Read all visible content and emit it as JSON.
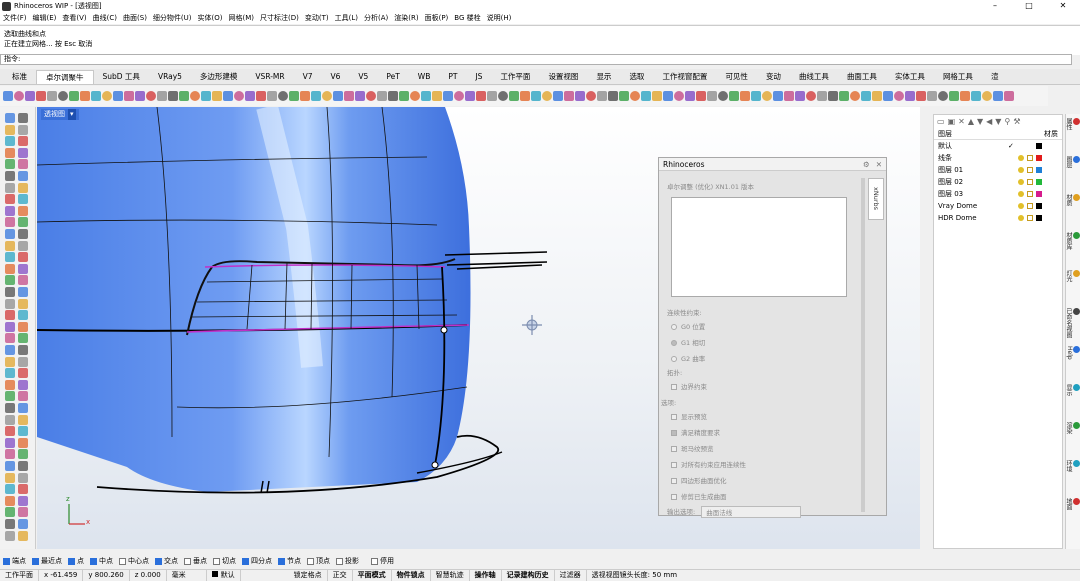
{
  "window": {
    "title": "Rhinoceros WIP - [透视图]",
    "controls": [
      "–",
      "□",
      "✕"
    ]
  },
  "menu": [
    "文件(F)",
    "编辑(E)",
    "查看(V)",
    "曲线(C)",
    "曲面(S)",
    "细分物件(U)",
    "实体(O)",
    "网格(M)",
    "尺寸标注(D)",
    "变动(T)",
    "工具(L)",
    "分析(A)",
    "渲染(R)",
    "面板(P)",
    "BG 楼栓",
    "说明(H)"
  ],
  "command": {
    "history1": "选取曲线和点",
    "history2": "正在建立网格... 按 Esc 取消",
    "prompt": "指令:"
  },
  "tabs": [
    "标准",
    "卓尔调聚牛",
    "SubD 工具",
    "VRay5",
    "多边形建模",
    "VSR-MR",
    "V7",
    "V6",
    "V5",
    "PeT",
    "WB",
    "PT",
    "JS",
    "工作平面",
    "设置视图",
    "显示",
    "选取",
    "工作视窗配置",
    "可见性",
    "变动",
    "曲线工具",
    "曲面工具",
    "实体工具",
    "网格工具",
    "渲"
  ],
  "viewport": {
    "label": "透视图",
    "label_arrow": "▾",
    "axis_z": "z",
    "axis_x": "x"
  },
  "panel": {
    "title": "Rhinoceros",
    "side_tab": "xNurbs",
    "heading": "卓尔调整 (优化) XN1.01 版本",
    "continuity_label": "连续性约束:",
    "radio": [
      "G0 位置",
      "G1 相切",
      "G2 曲率"
    ],
    "topology_label": "拓扑:",
    "boundary_check": "边界约束",
    "options_label": "选项:",
    "options": [
      "显示预览",
      "满足精度要求",
      "斑马纹预览",
      "对所有约束应用连续性",
      "四边形曲面优化",
      "修剪已生成曲面"
    ],
    "bottom_label": "输出选项:",
    "bottom_value": "曲面法线"
  },
  "layers": {
    "header_name": "图层",
    "header_material": "材质",
    "items": [
      {
        "name": "默认",
        "check": "✓",
        "color": "#000000"
      },
      {
        "name": "线条",
        "check": "",
        "color": "#e11b1b"
      },
      {
        "name": "图层 01",
        "check": "",
        "color": "#1e7fd6"
      },
      {
        "name": "图层 02",
        "check": "",
        "color": "#22b83a"
      },
      {
        "name": "图层 03",
        "check": "",
        "color": "#d61b8c"
      },
      {
        "name": "Vray Dome",
        "check": "",
        "color": "#000000"
      },
      {
        "name": "HDR Dome",
        "check": "",
        "color": "#000000"
      }
    ]
  },
  "side_tabs": [
    "属性",
    "图层",
    "材质",
    "材质库",
    "灯光",
    "已命名视图",
    "Help",
    "显示",
    "渲染",
    "环境",
    "地面"
  ],
  "osnap": [
    {
      "label": "端点",
      "on": true
    },
    {
      "label": "最近点",
      "on": true
    },
    {
      "label": "点",
      "on": true
    },
    {
      "label": "中点",
      "on": true
    },
    {
      "label": "中心点",
      "on": false
    },
    {
      "label": "交点",
      "on": true
    },
    {
      "label": "垂点",
      "on": false
    },
    {
      "label": "切点",
      "on": false
    },
    {
      "label": "四分点",
      "on": true
    },
    {
      "label": "节点",
      "on": true
    },
    {
      "label": "顶点",
      "on": false
    },
    {
      "label": "投影",
      "on": false
    },
    {
      "label": "停用",
      "on": false
    }
  ],
  "status": {
    "cplane": "工作平面",
    "x": "x -61.459",
    "y": "y 800.260",
    "z": "z 0.000",
    "unit": "毫米",
    "layer": "默认",
    "modes": [
      "锁定格点",
      "正交",
      "平面模式",
      "物件锁点",
      "智慧轨迹",
      "操作轴",
      "记录建构历史",
      "过滤器"
    ],
    "info": "透视视图镜头长度: 50 mm"
  }
}
